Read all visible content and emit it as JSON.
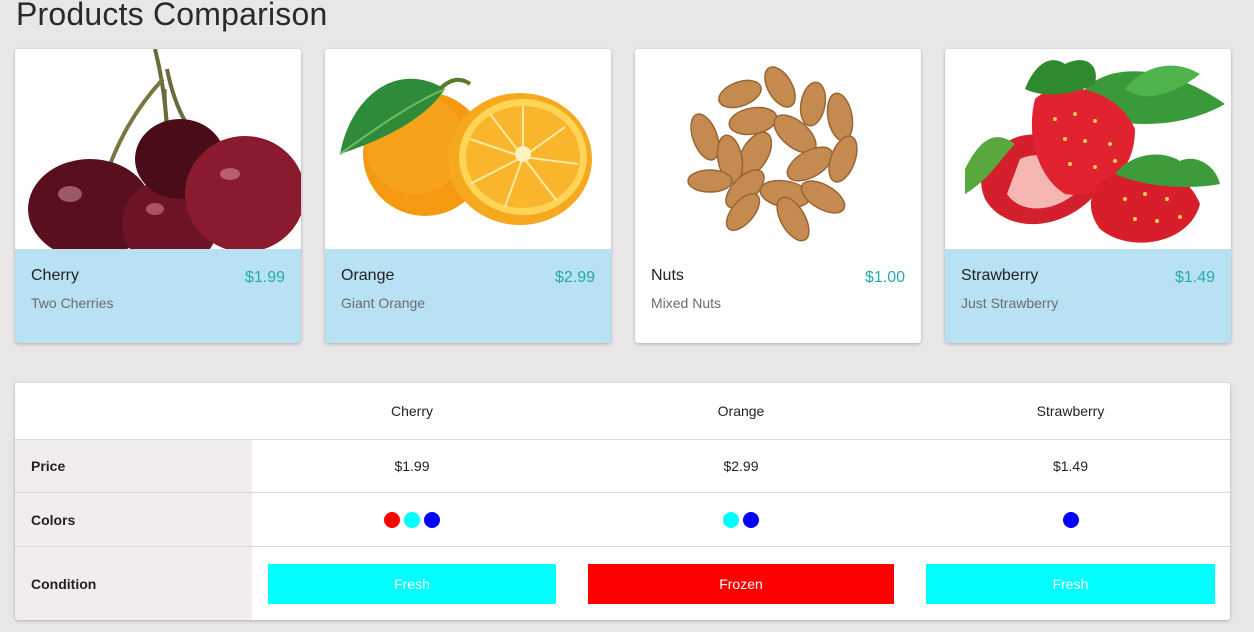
{
  "page": {
    "title": "Products Comparison"
  },
  "products": [
    {
      "name": "Cherry",
      "price": "$1.99",
      "description": "Two Cherries",
      "selected": true,
      "image_icon": "cherry-image"
    },
    {
      "name": "Orange",
      "price": "$2.99",
      "description": "Giant Orange",
      "selected": true,
      "image_icon": "orange-image"
    },
    {
      "name": "Nuts",
      "price": "$1.00",
      "description": "Mixed Nuts",
      "selected": false,
      "image_icon": "almonds-image"
    },
    {
      "name": "Strawberry",
      "price": "$1.49",
      "description": "Just Strawberry",
      "selected": true,
      "image_icon": "strawberry-image"
    }
  ],
  "comparison": {
    "columns": [
      "Cherry",
      "Orange",
      "Strawberry"
    ],
    "rows": {
      "price_label": "Price",
      "colors_label": "Colors",
      "condition_label": "Condition"
    },
    "prices": [
      "$1.99",
      "$2.99",
      "$1.49"
    ],
    "colors": [
      [
        "#ff0000",
        "#00ffff",
        "#0000ff"
      ],
      [
        "#00ffff",
        "#0000ff"
      ],
      [
        "#0000ff"
      ]
    ],
    "conditions": [
      {
        "label": "Fresh",
        "color": "#00ffff"
      },
      {
        "label": "Frozen",
        "color": "#ff0000"
      },
      {
        "label": "Fresh",
        "color": "#00ffff"
      }
    ]
  },
  "theme": {
    "accent_price_color": "#26a9ad",
    "selected_card_bg": "#b8e2f3"
  }
}
